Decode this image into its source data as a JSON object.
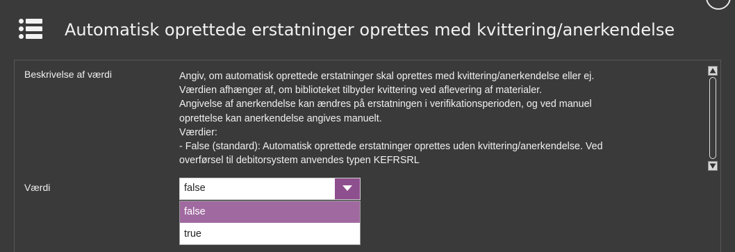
{
  "header": {
    "title": "Automatisk oprettede erstatninger oprettes med kvittering/anerkendelse"
  },
  "description": {
    "label": "Beskrivelse af værdi",
    "lines": [
      "Angiv, om automatisk oprettede erstatninger skal oprettes med kvittering/anerkendelse eller ej.",
      "Værdien afhænger af, om biblioteket tilbyder kvittering ved aflevering af materialer.",
      "Angivelse af anerkendelse kan ændres på erstatningen i verifikationsperioden, og ved manuel",
      "oprettelse kan anerkendelse angives manuelt.",
      "Værdier:",
      "- False (standard): Automatisk oprettede erstatninger oprettes uden kvittering/anerkendelse. Ved",
      "overførsel til debitorsystem anvendes typen KEFRSRL"
    ]
  },
  "value": {
    "label": "Værdi",
    "selected": "false",
    "options": [
      {
        "label": "false",
        "highlighted": true
      },
      {
        "label": "true",
        "highlighted": false
      }
    ]
  },
  "colors": {
    "background": "#3a3a3a",
    "accent": "#8e4f8e",
    "highlight": "#a06aa0"
  },
  "icons": [
    "menu-list-icon",
    "chevron-down-icon",
    "scroll-up-arrow-icon",
    "scroll-down-arrow-icon"
  ]
}
